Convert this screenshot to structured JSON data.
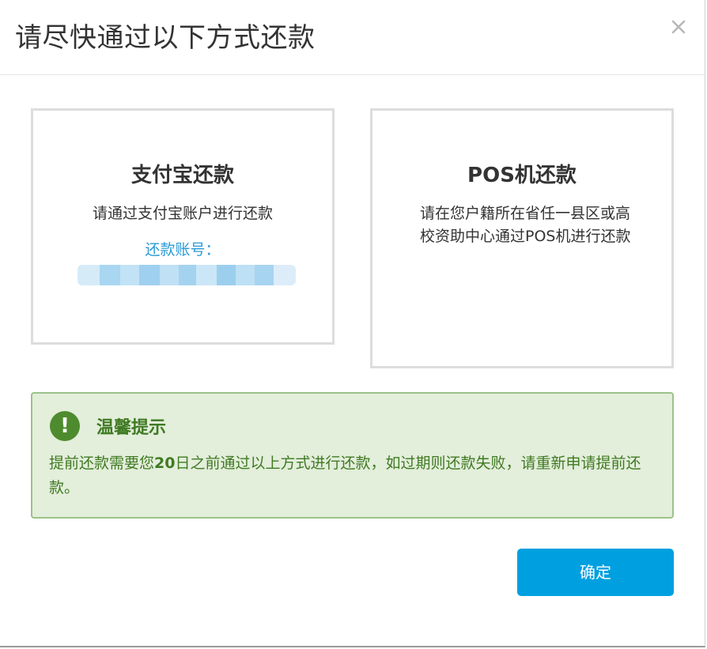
{
  "modal": {
    "title": "请尽快通过以下方式还款",
    "close_icon": "close-icon"
  },
  "alipay_card": {
    "title": "支付宝还款",
    "description": "请通过支付宝账户进行还款",
    "account_label": "还款账号："
  },
  "pos_card": {
    "title": "POS机还款",
    "description": "请在您户籍所在省任一县区或高校资助中心通过POS机进行还款"
  },
  "notice": {
    "icon": "exclamation-icon",
    "title": "温馨提示",
    "text_before": "提前还款需要您",
    "days": "20",
    "text_after": "日之前通过以上方式进行还款，如过期则还款失败，请重新申请提前还款。"
  },
  "footer": {
    "confirm_label": "确定"
  },
  "colors": {
    "primary_button": "#00a0e0",
    "link_blue": "#2b9bd6",
    "notice_bg": "#e3eedb",
    "notice_text": "#3f7a22",
    "notice_icon_bg": "#4e8b2e"
  }
}
